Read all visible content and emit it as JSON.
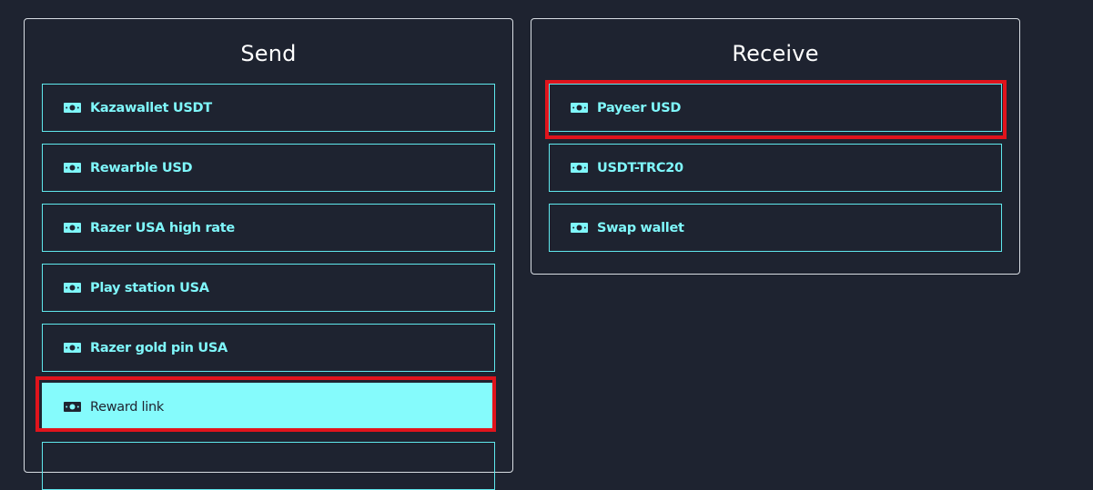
{
  "send": {
    "title": "Send",
    "options": [
      {
        "label": "Kazawallet USDT",
        "icon": "money-bill-icon"
      },
      {
        "label": "Rewarble USD",
        "icon": "money-bill-icon"
      },
      {
        "label": "Razer USA high rate",
        "icon": "money-bill-icon"
      },
      {
        "label": "Play station USA",
        "icon": "money-bill-icon"
      },
      {
        "label": "Razer gold pin USA",
        "icon": "money-bill-icon"
      },
      {
        "label": "Reward link",
        "icon": "money-bill-icon",
        "selected": true
      }
    ]
  },
  "receive": {
    "title": "Receive",
    "options": [
      {
        "label": "Payeer USD",
        "icon": "money-bill-icon",
        "highlighted": true
      },
      {
        "label": "USDT-TRC20",
        "icon": "money-bill-icon"
      },
      {
        "label": "Swap wallet",
        "icon": "money-bill-icon"
      }
    ]
  },
  "colors": {
    "background": "#1e2330",
    "accent": "#7ff7fb",
    "selected_background": "#85fbfc",
    "highlight_border": "#e0141c"
  }
}
